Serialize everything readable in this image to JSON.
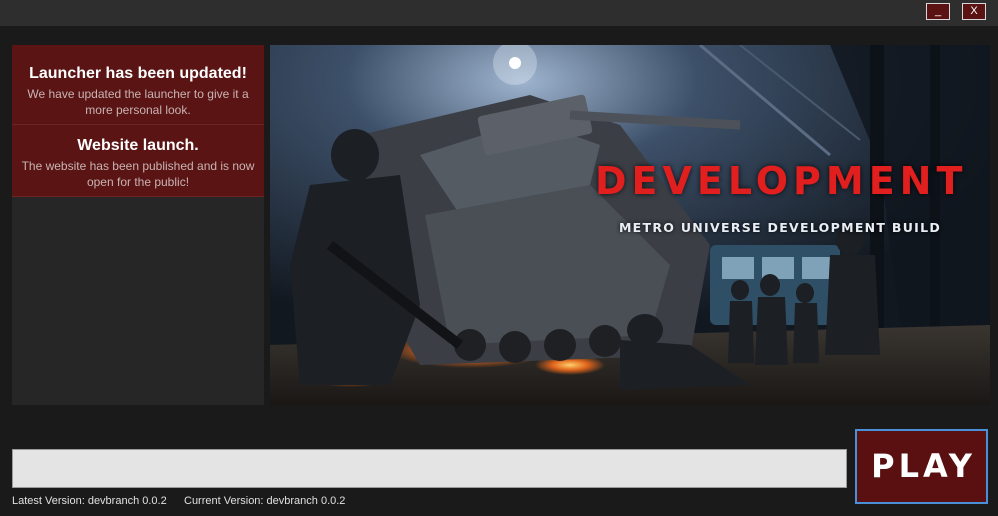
{
  "window": {
    "minimize_label": "_",
    "close_label": "X"
  },
  "news": {
    "items": [
      {
        "title": "Launcher has been updated!",
        "body": "We have updated the launcher to give it a more personal look."
      },
      {
        "title": "Website launch.",
        "body": "The website has been published and is now open for the public!"
      }
    ]
  },
  "banner": {
    "title": "DEVELOPMENT",
    "subtitle": "METRO UNIVERSE DEVELOPMENT BUILD"
  },
  "progress": {
    "fraction": 0
  },
  "play": {
    "label": "PLAY"
  },
  "versions": {
    "latest": "Latest Version: devbranch 0.0.2",
    "current": "Current Version: devbranch 0.0.2"
  },
  "colors": {
    "accent": "#5a1414",
    "banner_title": "#e11f1f",
    "play_border": "#4a90d9"
  }
}
